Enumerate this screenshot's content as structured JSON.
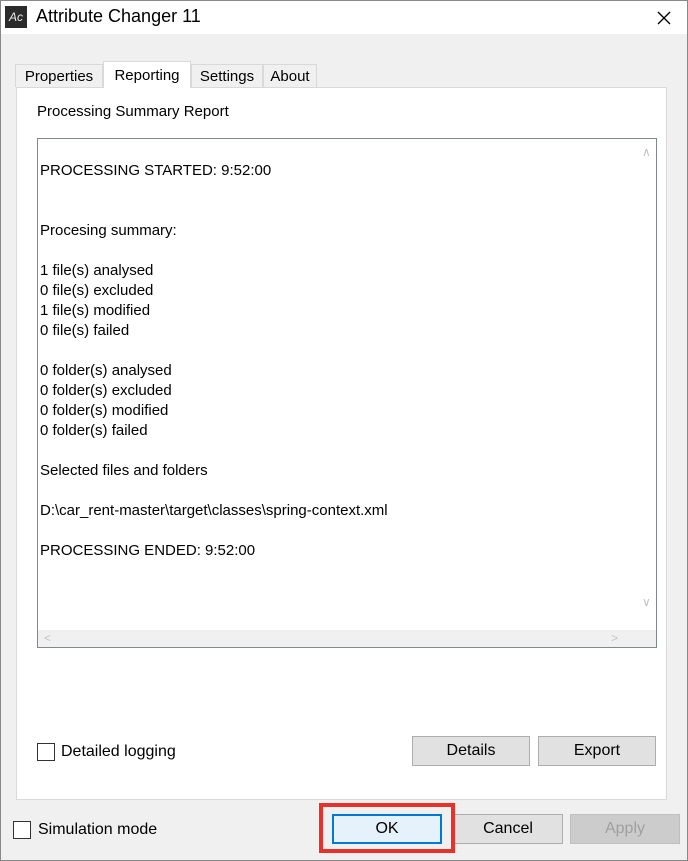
{
  "window": {
    "title": "Attribute Changer 11",
    "app_icon_text": "Ac"
  },
  "tabs": [
    {
      "label": "Properties",
      "active": false
    },
    {
      "label": "Reporting",
      "active": true
    },
    {
      "label": "Settings",
      "active": false
    },
    {
      "label": "About",
      "active": false
    }
  ],
  "report": {
    "heading": "Processing Summary Report",
    "lines": [
      "PROCESSING STARTED: 9:52:00",
      "",
      "",
      "Procesing summary:",
      "",
      "1 file(s) analysed",
      "0 file(s) excluded",
      "1 file(s) modified",
      "0 file(s) failed",
      "",
      "0 folder(s) analysed",
      "0 folder(s) excluded",
      "0 folder(s) modified",
      "0 folder(s) failed",
      "",
      "Selected files and folders",
      "",
      "D:\\car_rent-master\\target\\classes\\spring-context.xml",
      "",
      "PROCESSING ENDED: 9:52:00"
    ]
  },
  "options": {
    "detailed_logging_label": "Detailed logging",
    "simulation_mode_label": "Simulation mode"
  },
  "buttons": {
    "details": "Details",
    "export": "Export",
    "ok": "OK",
    "cancel": "Cancel",
    "apply": "Apply"
  },
  "colors": {
    "highlight": "#e8312b",
    "default_button_border": "#0078d7"
  }
}
